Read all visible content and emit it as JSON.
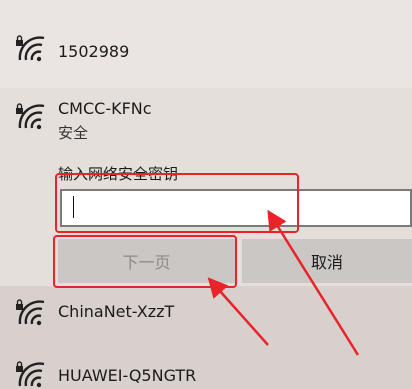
{
  "networks": [
    {
      "name": "1502989"
    },
    {
      "name": "CMCC-KFNc",
      "status": "安全"
    },
    {
      "name": "ChinaNet-XzzT"
    },
    {
      "name": "HUAWEI-Q5NGTR"
    }
  ],
  "connect": {
    "key_label": "输入网络安全密钥",
    "password_value": "",
    "next_label": "下一页",
    "cancel_label": "取消"
  },
  "icons": {
    "wifi": "wifi-secured-icon"
  },
  "colors": {
    "highlight": "#e8242a",
    "button_bg": "#cbc7c5",
    "disabled_text": "#8b8b8b"
  }
}
